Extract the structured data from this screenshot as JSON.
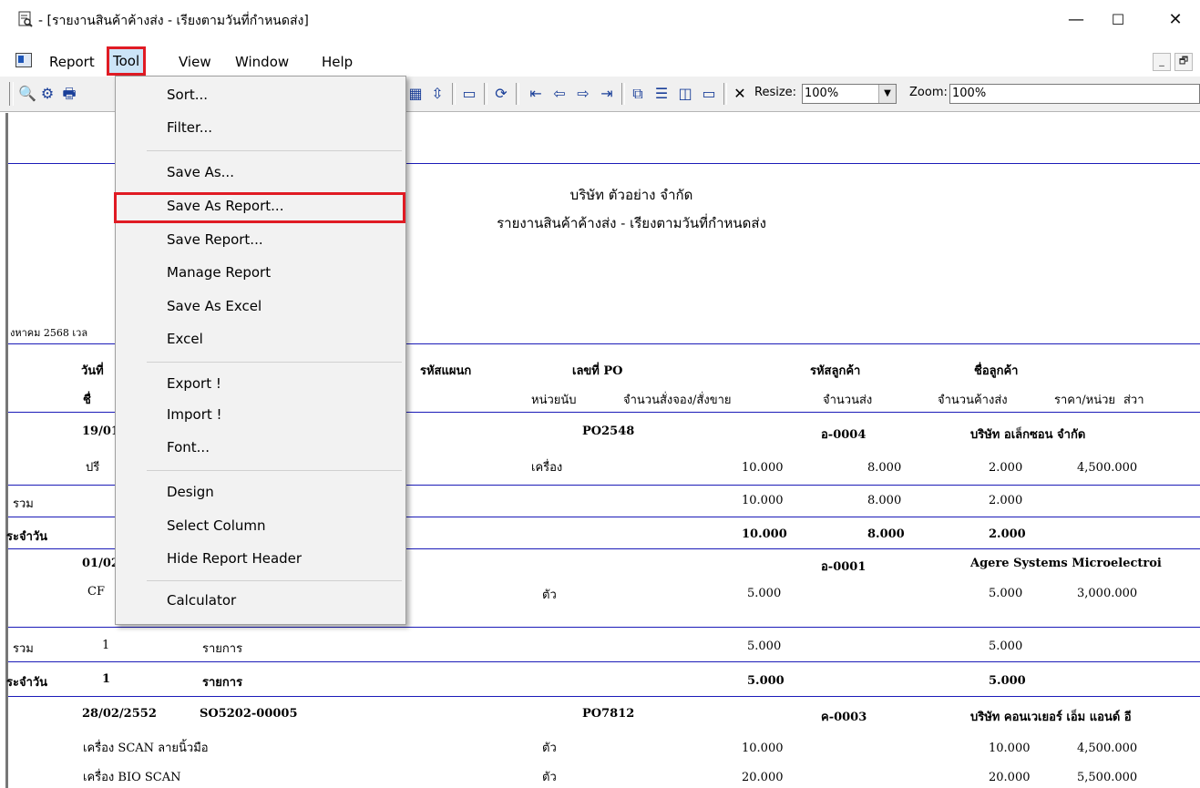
{
  "window": {
    "title": "- [รายงานสินค้าค้างส่ง - เรียงตามวันที่กำหนดส่ง]",
    "minimize": "—",
    "maximize": "☐",
    "close": "✕"
  },
  "menubar": {
    "items": [
      "Report",
      "Tool",
      "View",
      "Window",
      "Help"
    ],
    "mdi_minimize": "_",
    "mdi_restore": "🗗"
  },
  "toolbar": {
    "resize_label": "Resize:",
    "resize_value": "100%",
    "zoom_label": "Zoom:",
    "zoom_value": "100%",
    "close_glyph": "✕"
  },
  "tool_menu": {
    "items": [
      "Sort...",
      "Filter...",
      "Save As...",
      "Save As Report...",
      "Save Report...",
      "Manage Report",
      "Save As Excel",
      "Excel",
      "Export !",
      "Import !",
      "Font...",
      "Design",
      "Select Column",
      "Hide Report Header",
      "Calculator"
    ],
    "highlighted": "Save As Report..."
  },
  "report": {
    "company": "บริษัท ตัวอย่าง จำกัด",
    "title": "รายงานสินค้าค้างส่ง - เรียงตามวันที่กำหนดส่ง",
    "print_date": "งหาคม 2568 เวล",
    "headers_row1": {
      "c0": "",
      "date": "วันที่",
      "dept": "รหัสแผนก",
      "po": "เลขที่ PO",
      "cust_code": "รหัสลูกค้า",
      "cust_name": "ชื่อลูกค้า"
    },
    "headers_row2": {
      "name": "ชื่",
      "unit": "หน่วยนับ",
      "qty_order": "จำนวนสั่งจอง/สั่งขาย",
      "qty_sent": "จำนวนส่ง",
      "qty_pending": "จำนวนค้างส่ง",
      "price": "ราคา/หน่วย",
      "disc": "ส่วา"
    },
    "g1": {
      "date": "19/01",
      "po": "PO2548",
      "cust_code": "อ-0004",
      "cust_name": "บริษัท อเล็กซอน จำกัด",
      "item": "ปรี",
      "unit": "เครื่อง",
      "qty": "10.000",
      "sent": "8.000",
      "pending": "2.000",
      "price": "4,500.000",
      "sum_label": "รวม",
      "sum_qty": "10.000",
      "sum_sent": "8.000",
      "sum_pending": "2.000",
      "day_label": "ระจำวัน",
      "day_qty": "10.000",
      "day_sent": "8.000",
      "day_pending": "2.000"
    },
    "g2": {
      "date": "01/02",
      "cust_code": "อ-0001",
      "cust_name": "Agere Systems Microelectroi",
      "item": "CF",
      "unit": "ตัว",
      "qty": "5.000",
      "pending": "5.000",
      "price": "3,000.000",
      "sum_label": "รวม",
      "sum_count": "1",
      "sum_unit": "รายการ",
      "sum_qty": "5.000",
      "sum_pending": "5.000",
      "day_label": "ระจำวัน",
      "day_count": "1",
      "day_unit": "รายการ",
      "day_qty": "5.000",
      "day_pending": "5.000"
    },
    "g3": {
      "date": "28/02/2552",
      "so": "SO5202-00005",
      "po": "PO7812",
      "cust_code": "ค-0003",
      "cust_name": "บริษัท คอนเวเยอร์ เอ็ม แอนด์ อี",
      "item1": "เครื่อง SCAN ลายนิ้วมือ",
      "unit1": "ตัว",
      "qty1": "10.000",
      "pending1": "10.000",
      "price1": "4,500.000",
      "item2": "เครื่อง BIO SCAN",
      "unit2": "ตัว",
      "qty2": "20.000",
      "pending2": "20.000",
      "price2": "5,500.000"
    }
  }
}
